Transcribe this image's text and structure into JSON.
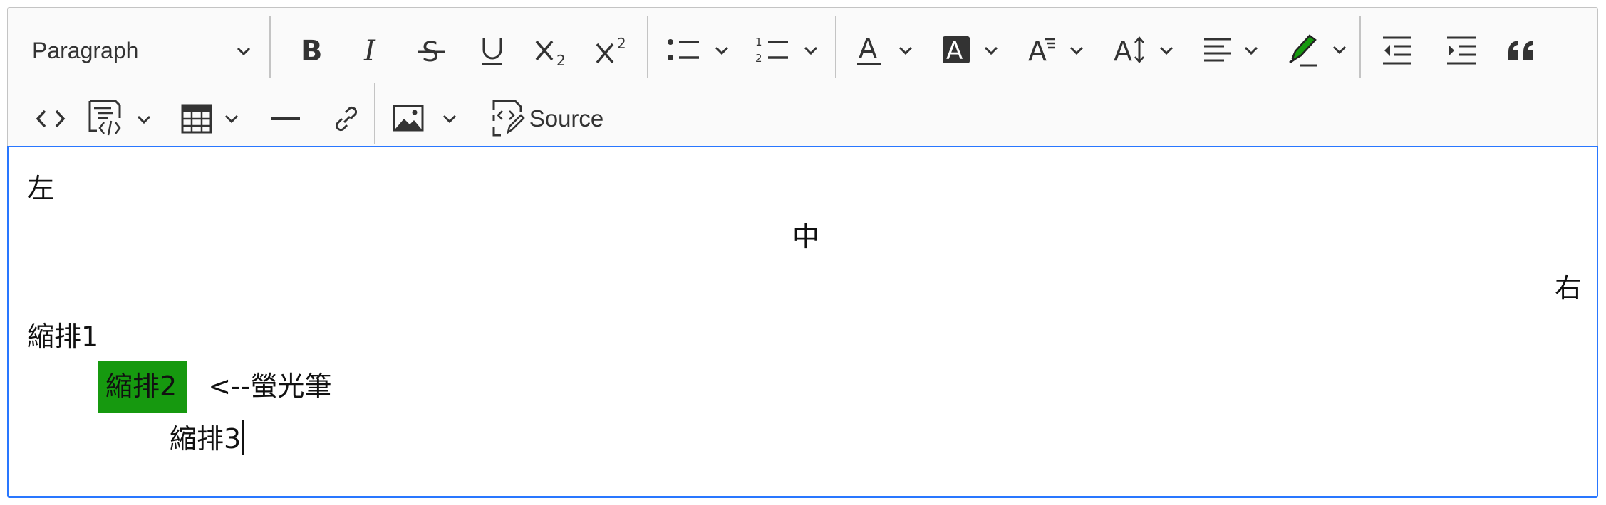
{
  "toolbar": {
    "heading_label": "Paragraph",
    "source_label": "Source",
    "buttons": [
      "bold",
      "italic",
      "strikethrough",
      "underline",
      "subscript",
      "superscript",
      "bulleted-list",
      "numbered-list",
      "font-color",
      "font-background-color",
      "font-family",
      "font-size",
      "alignment",
      "highlight",
      "outdent",
      "indent",
      "block-quote",
      "code",
      "insert-code-block",
      "insert-table",
      "horizontal-line",
      "link",
      "insert-image",
      "source"
    ],
    "subscript_digit": "2",
    "superscript_digit": "2"
  },
  "colors": {
    "highlight": "#16990f",
    "focus_border": "#2977ff",
    "toolbar_bg": "#fafafa"
  },
  "content": {
    "left": "左",
    "center": "中",
    "right": "右",
    "indent1": "縮排1",
    "indent2_highlighted": "縮排2",
    "indent2_note": "<--螢光筆",
    "indent3": "縮排3"
  }
}
